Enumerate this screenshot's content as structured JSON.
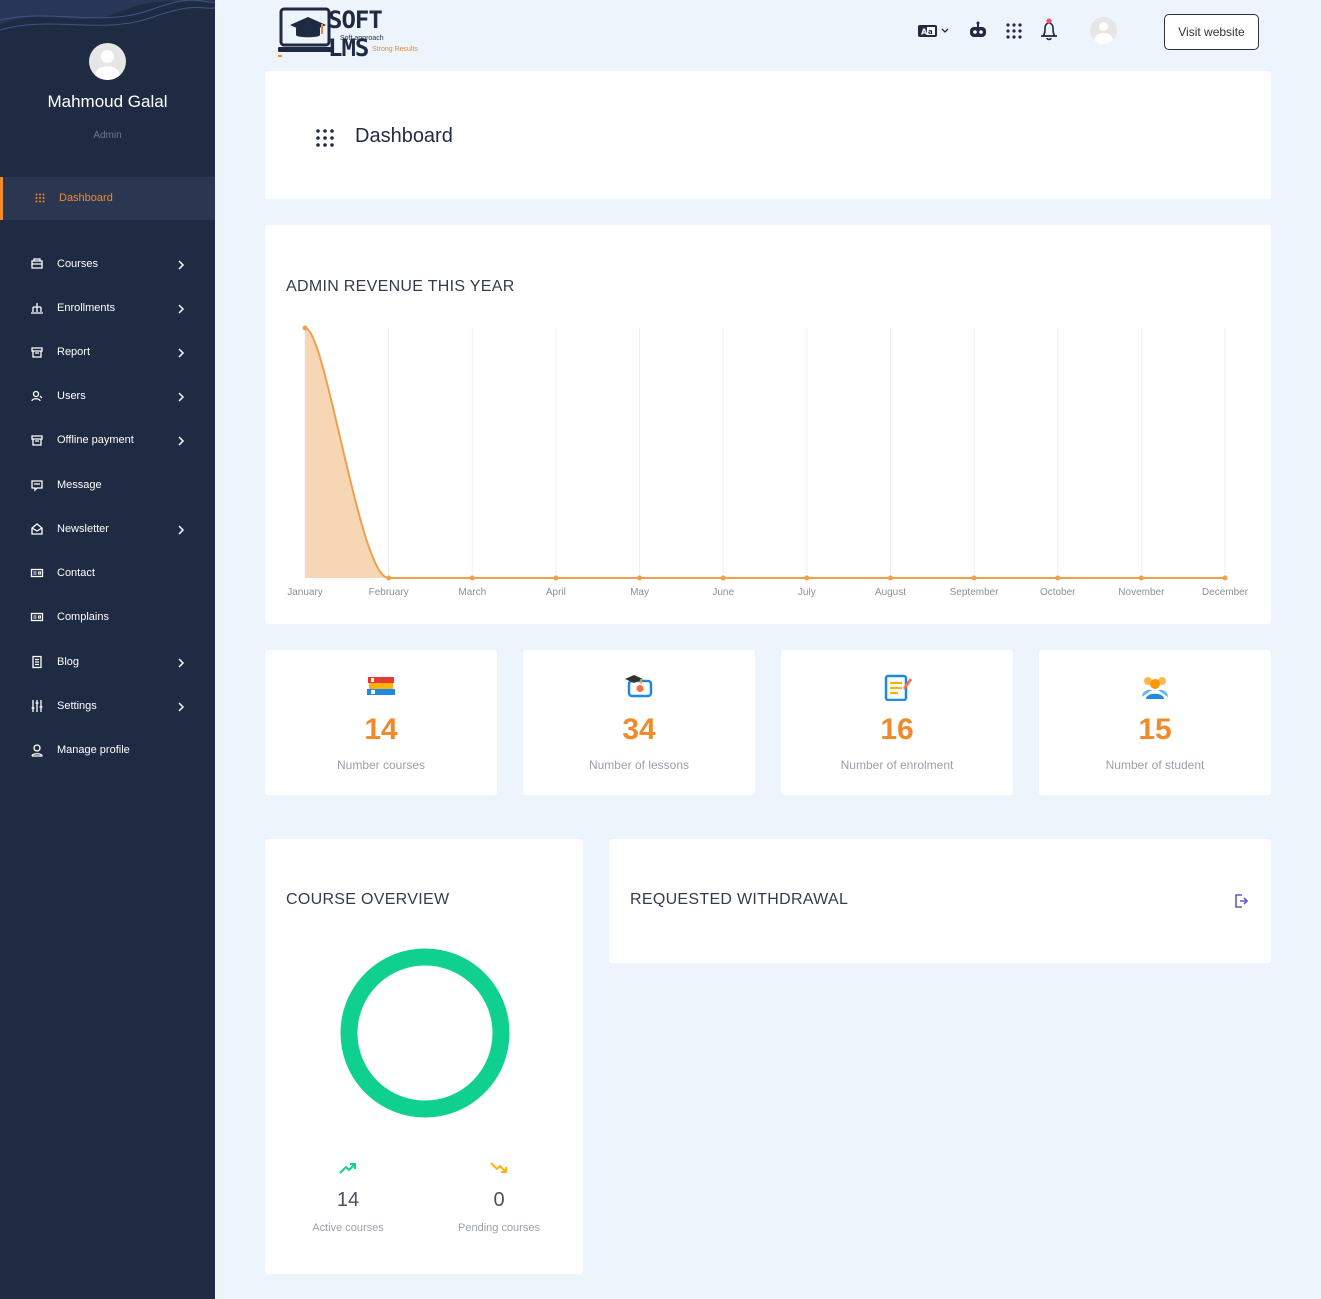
{
  "sidebar": {
    "user_name": "Mahmoud Galal",
    "user_role": "Admin",
    "active_item": {
      "label": "Dashboard",
      "icon": "grid-icon"
    },
    "items": [
      {
        "label": "Courses",
        "icon": "courses-icon",
        "has_submenu": true
      },
      {
        "label": "Enrollments",
        "icon": "enrollments-icon",
        "has_submenu": true
      },
      {
        "label": "Report",
        "icon": "report-icon",
        "has_submenu": true
      },
      {
        "label": "Users",
        "icon": "users-icon",
        "has_submenu": true
      },
      {
        "label": "Offline payment",
        "icon": "payment-icon",
        "has_submenu": true
      },
      {
        "label": "Message",
        "icon": "message-icon",
        "has_submenu": false
      },
      {
        "label": "Newsletter",
        "icon": "newsletter-icon",
        "has_submenu": true
      },
      {
        "label": "Contact",
        "icon": "contact-icon",
        "has_submenu": false
      },
      {
        "label": "Complains",
        "icon": "complains-icon",
        "has_submenu": false
      },
      {
        "label": "Blog",
        "icon": "blog-icon",
        "has_submenu": true
      },
      {
        "label": "Settings",
        "icon": "settings-icon",
        "has_submenu": true
      },
      {
        "label": "Manage profile",
        "icon": "profile-icon",
        "has_submenu": false
      }
    ]
  },
  "header": {
    "logo_text": "SOFT LMS",
    "logo_tagline_1": "Soft approach",
    "logo_tagline_2": "Strong Results",
    "visit_label": "Visit website"
  },
  "page": {
    "title": "Dashboard"
  },
  "revenue": {
    "title": "ADMIN REVENUE THIS YEAR"
  },
  "chart_data": {
    "type": "area",
    "title": "ADMIN REVENUE THIS YEAR",
    "categories": [
      "January",
      "February",
      "March",
      "April",
      "May",
      "June",
      "July",
      "August",
      "September",
      "October",
      "November",
      "December"
    ],
    "values": [
      1,
      0,
      0,
      0,
      0,
      0,
      0,
      0,
      0,
      0,
      0,
      0
    ],
    "grid": "vertical",
    "colors": {
      "line": "#f0a04b",
      "fill": "#f7d6b6"
    }
  },
  "stats": [
    {
      "value": "14",
      "label": "Number courses",
      "icon": "books-icon"
    },
    {
      "value": "34",
      "label": "Number of lessons",
      "icon": "lesson-icon"
    },
    {
      "value": "16",
      "label": "Number of enrolment",
      "icon": "enrolment-icon"
    },
    {
      "value": "15",
      "label": "Number of student",
      "icon": "students-icon"
    }
  ],
  "course_overview": {
    "title": "COURSE OVERVIEW",
    "active_value": "14",
    "active_label": "Active courses",
    "pending_value": "0",
    "pending_label": "Pending courses",
    "donut_color": "#10d08f"
  },
  "withdrawal": {
    "title": "REQUESTED WITHDRAWAL"
  },
  "colors": {
    "sidebar_bg": "#1f2b42",
    "accent": "#f08a2b",
    "page_bg": "#eef4fb"
  }
}
